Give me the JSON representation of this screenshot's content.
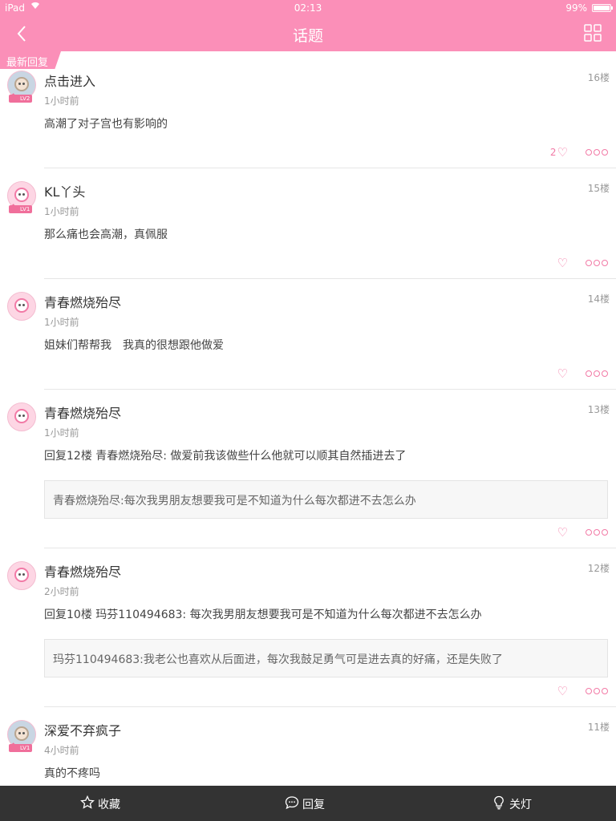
{
  "status": {
    "carrier": "iPad",
    "time": "02:13",
    "battery": "99%",
    "battery_level": 0.99
  },
  "nav": {
    "title": "话题"
  },
  "section_tag": "最新回复",
  "posts": [
    {
      "name": "点击进入",
      "floor": "16楼",
      "time": "1小时前",
      "content": "高潮了对子宫也有影响的",
      "likes": "2",
      "level": "LV2",
      "avatar": "photo-avatar"
    },
    {
      "name": "KL丫头",
      "floor": "15楼",
      "time": "1小时前",
      "content": "那么痛也会高潮，真佩服",
      "likes": "",
      "level": "LV1",
      "avatar": "default-avatar"
    },
    {
      "name": "青春燃烧殆尽",
      "floor": "14楼",
      "time": "1小时前",
      "content": "姐妹们帮帮我　我真的很想跟他做爱",
      "likes": "",
      "level": "",
      "avatar": "default-avatar"
    },
    {
      "name": "青春燃烧殆尽",
      "floor": "13楼",
      "time": "1小时前",
      "content": "回复12楼 青春燃烧殆尽: 做爱前我该做些什么他就可以顺其自然插进去了",
      "quote": "青春燃烧殆尽:每次我男朋友想要我可是不知道为什么每次都进不去怎么办",
      "likes": "",
      "level": "",
      "avatar": "default-avatar"
    },
    {
      "name": "青春燃烧殆尽",
      "floor": "12楼",
      "time": "2小时前",
      "content": "回复10楼 玛芬110494683: 每次我男朋友想要我可是不知道为什么每次都进不去怎么办",
      "quote": "玛芬110494683:我老公也喜欢从后面进，每次我鼓足勇气可是进去真的好痛，还是失败了",
      "likes": "",
      "level": "",
      "avatar": "default-avatar"
    },
    {
      "name": "深爱不弃疯子",
      "floor": "11楼",
      "time": "4小时前",
      "content": "真的不疼吗",
      "likes": "",
      "level": "LV1",
      "avatar": "photo-avatar"
    }
  ],
  "bottom": {
    "favorite": "收藏",
    "reply": "回复",
    "lights_off": "关灯"
  },
  "colors": {
    "accent": "#fb8fb8",
    "bottom_bar": "#333333"
  }
}
